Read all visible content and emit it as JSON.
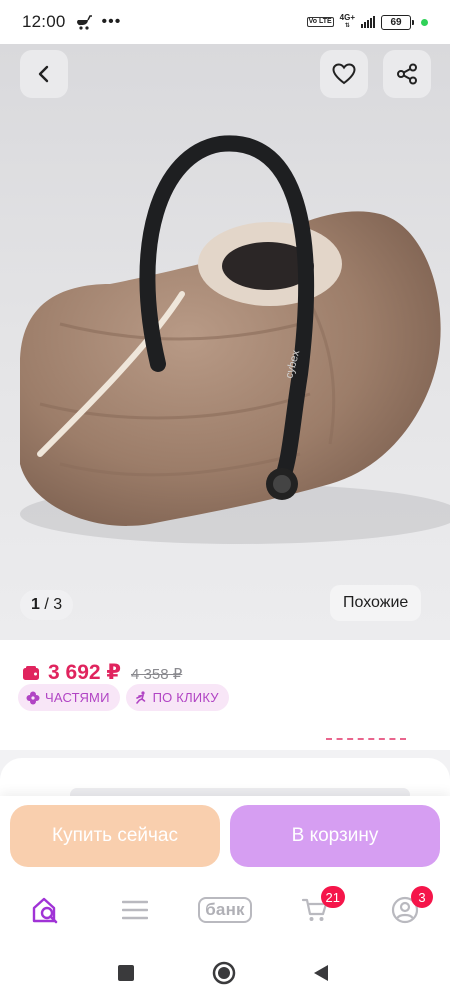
{
  "status_bar": {
    "time": "12:00",
    "volte": "Vo LTE",
    "network": "4G+",
    "battery": "69"
  },
  "gallery": {
    "current_index": "1",
    "separator": "/",
    "total": "3",
    "similar_label": "Похожие",
    "brand_mark": "cybex"
  },
  "price": {
    "current": "3 692 ₽",
    "old": "4 358 ₽",
    "badges": [
      "ЧАСТЯМИ",
      "ПО КЛИКУ"
    ]
  },
  "actions": {
    "buy_now": "Купить сейчас",
    "to_cart": "В корзину"
  },
  "bottom_nav": {
    "bank_label": "банк",
    "cart_count": "21",
    "profile_count": "3"
  },
  "colors": {
    "accent_price": "#e0245e",
    "badge_text": "#b144c4",
    "buy_now_bg": "#f9cfae",
    "to_cart_bg": "#d69ef2",
    "nav_active": "#a033d6",
    "notification": "#f5154a"
  }
}
